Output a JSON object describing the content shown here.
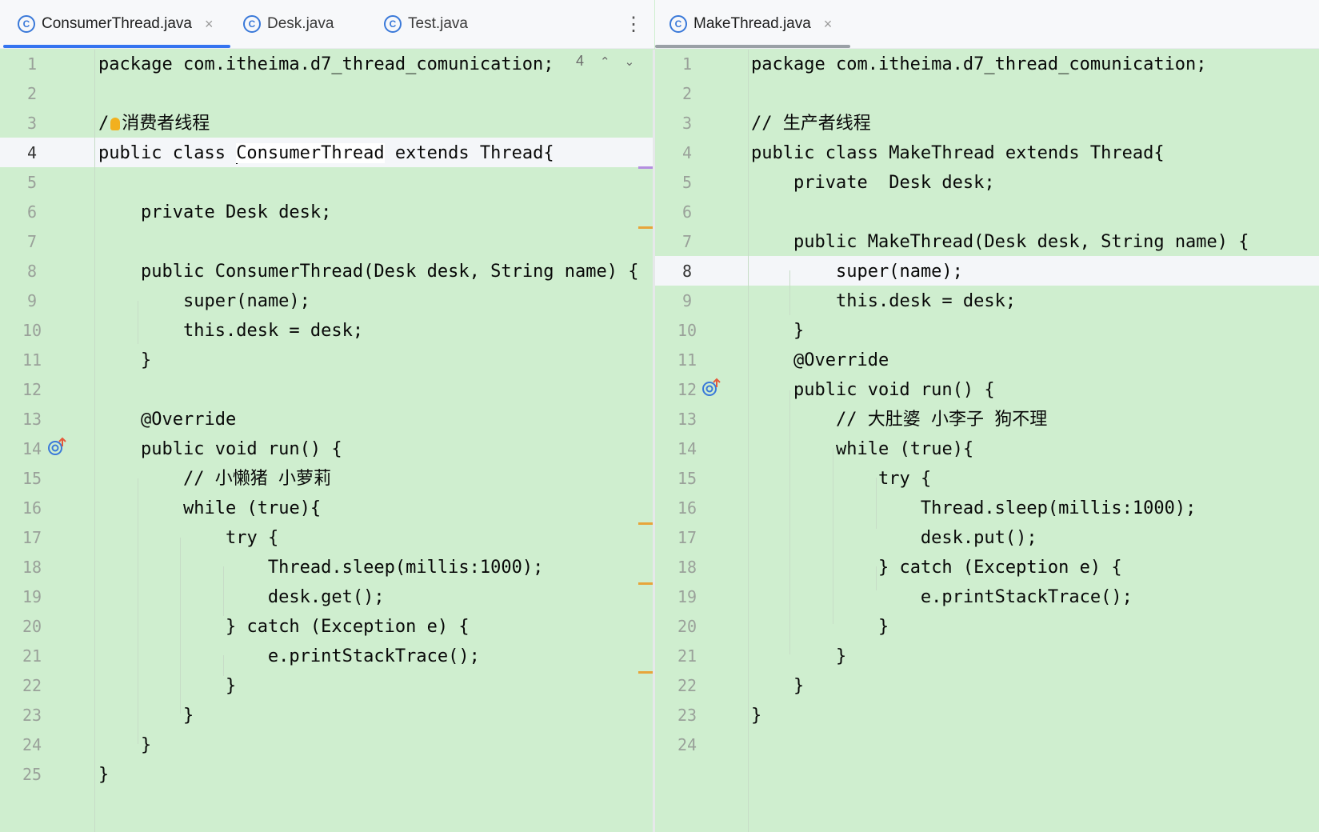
{
  "left_tabs": [
    {
      "label": "ConsumerThread.java",
      "active": true
    },
    {
      "label": "Desk.java"
    },
    {
      "label": "Test.java"
    }
  ],
  "right_tabs": [
    {
      "label": "MakeThread.java",
      "active": true
    }
  ],
  "tab_icon_letter": "C",
  "menu_icon": "⋮",
  "close_icon": "×",
  "warning": {
    "count": "4"
  },
  "colors": {
    "background": "#cfeecf",
    "keyword": "#0033b3",
    "field": "#871094",
    "annotation": "#9e880d",
    "comment": "#8c8c8c",
    "number": "#1750eb",
    "method": "#00627a",
    "accent": "#3574f0"
  },
  "left_line_numbers": [
    "1",
    "2",
    "3",
    "4",
    "5",
    "6",
    "7",
    "8",
    "9",
    "10",
    "11",
    "12",
    "13",
    "14",
    "15",
    "16",
    "17",
    "18",
    "19",
    "20",
    "21",
    "22",
    "23",
    "24",
    "25"
  ],
  "right_line_numbers": [
    "1",
    "2",
    "3",
    "4",
    "5",
    "6",
    "7",
    "8",
    "9",
    "10",
    "11",
    "12",
    "13",
    "14",
    "15",
    "16",
    "17",
    "18",
    "19",
    "20",
    "21",
    "22",
    "23",
    "24"
  ],
  "left_tokens": {
    "package_kw": "package",
    "package_name": " com.itheima.d7_thread_comunication;",
    "comment_prefix": "/",
    "comment_slash2": "/ ",
    "comment_text": "消费者线程",
    "class_line_kw": "public class ",
    "class_name": "ConsumerThread",
    "extends_kw": " extends ",
    "super_name": "Thread{",
    "private_kw": "private",
    "desk_type": " Desk ",
    "desk_field": "desk",
    "semicolon": ";",
    "ctor_kw": "public ",
    "ctor_name": "ConsumerThread",
    "ctor_params": "(Desk desk, String name) {",
    "super_kw": "super",
    "super_args": "(name);",
    "this_kw": "this",
    "dot": ".",
    "assign": " = desk;",
    "brace_close": "}",
    "override": "@Override",
    "run_kw": "public void ",
    "run_name": "run",
    "run_rest": "() {",
    "comment2": "// 小懒猪 小萝莉",
    "while_kw": "while",
    "while_rest_a": " (",
    "true_kw": "true",
    "while_rest_b": "){",
    "try_kw": "try",
    "try_rest": " {",
    "thread": "Thread.",
    "sleep": "sleep",
    "paren_open": "(",
    "hint": "millis:",
    "num": "1000",
    "paren_close": ");",
    "desk_call": ".get();",
    "catch_a": "} ",
    "catch_kw": "catch",
    "catch_rest": " (Exception e) {",
    "e_dot": "e.",
    "print": "printStackTrace",
    "print_end": "();"
  },
  "right_tokens": {
    "package_kw": "package",
    "package_name": " com.itheima.d7_thread_comunication;",
    "comment": "// 生产者线程",
    "class_line_kw": "public class ",
    "class_name": "MakeThread",
    "extends_kw": " extends ",
    "super_name": "Thread{",
    "private_kw": "private",
    "desk_type": "  Desk ",
    "desk_field": "desk",
    "semicolon": ";",
    "ctor_kw": "public ",
    "ctor_name": "MakeThread",
    "ctor_params": "(Desk desk, String name) {",
    "super_kw": "super",
    "super_args": "(name);",
    "this_kw": "this",
    "dot": ".",
    "assign": " = desk;",
    "brace_close": "}",
    "override": "@Override",
    "run_kw": "public void ",
    "run_name": "run",
    "run_rest": "() {",
    "comment2": "// 大肚婆 小李子 狗不理",
    "while_kw": "while",
    "while_rest_a": " (",
    "true_kw": "true",
    "while_rest_b": "){",
    "try_kw": "try",
    "try_rest": " {",
    "thread": "Thread.",
    "sleep": "sleep",
    "paren_open": "(",
    "hint": "millis:",
    "num": "1000",
    "paren_close": ");",
    "desk_call": ".put();",
    "catch_a": "} ",
    "catch_kw": "catch",
    "catch_rest": " (Exception e) {",
    "e_dot": "e.",
    "print": "printStackTrace",
    "print_end": "();"
  }
}
